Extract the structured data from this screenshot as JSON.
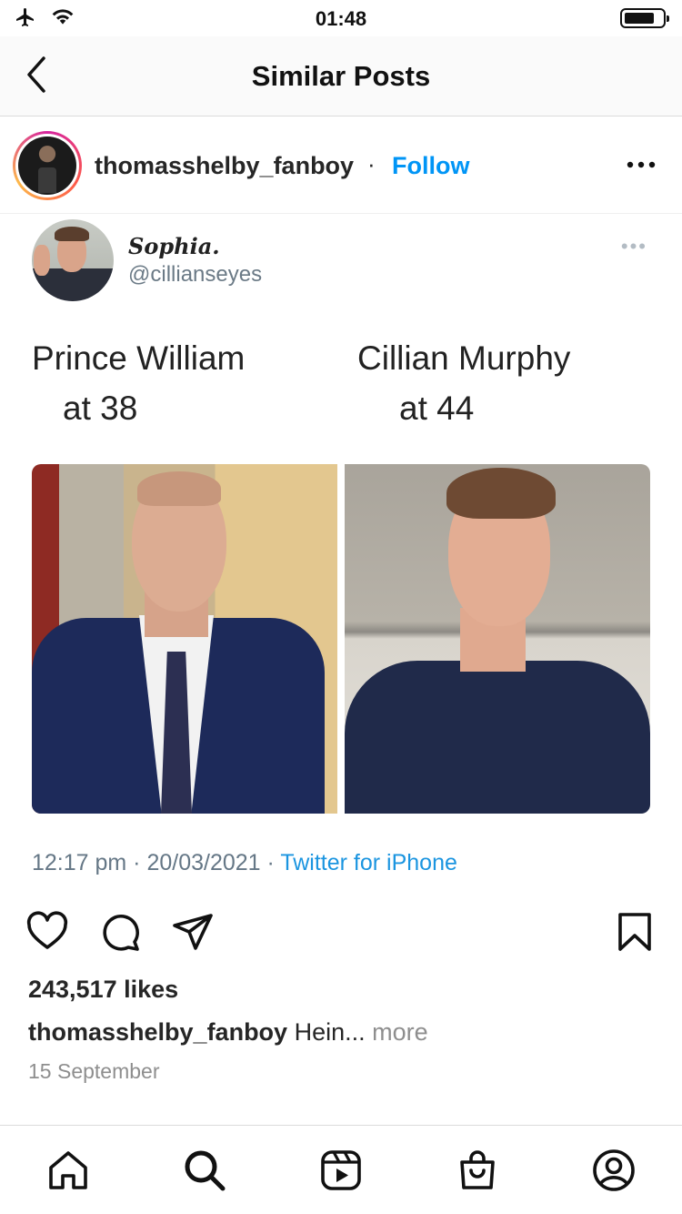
{
  "status_bar": {
    "time": "01:48"
  },
  "nav": {
    "title": "Similar Posts"
  },
  "post": {
    "username": "thomasshelby_fanboy",
    "separator": "·",
    "follow_label": "Follow",
    "likes": "243,517 likes",
    "caption_user": "thomasshelby_fanboy",
    "caption_text": "Hein...",
    "caption_more": "more",
    "date": "15 September"
  },
  "tweet": {
    "display_name": "Sophia.",
    "handle": "@cillianseyes",
    "left_label_line1": "Prince William",
    "left_label_line2": "at 38",
    "right_label_line1": "Cillian Murphy",
    "right_label_line2": "at 44",
    "timestamp": "12:17 pm · 20/03/2021 · ",
    "source": "Twitter for iPhone"
  },
  "icons": {
    "status": [
      "airplane-icon",
      "wifi-icon",
      "battery-icon"
    ],
    "actions": [
      "heart-icon",
      "comment-icon",
      "share-icon",
      "bookmark-icon"
    ],
    "tabs": [
      "home-icon",
      "search-icon",
      "reels-icon",
      "shop-icon",
      "profile-icon"
    ]
  },
  "colors": {
    "accent": "#0095f6",
    "link_twitter": "#1b95e0",
    "muted": "#8e8e8e"
  }
}
